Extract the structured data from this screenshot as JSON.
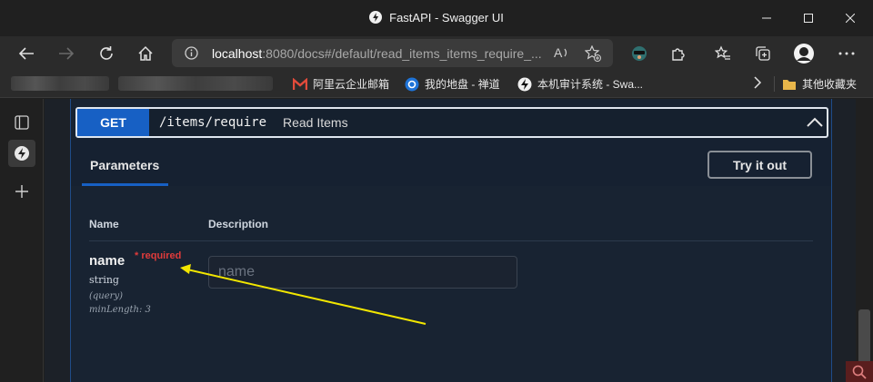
{
  "window": {
    "title": "FastAPI - Swagger UI"
  },
  "toolbar": {
    "url_host": "localhost",
    "url_rest": ":8080/docs#/default/read_items_items_require_..."
  },
  "bookmarks": {
    "items": [
      {
        "label": "阿里云企业邮箱"
      },
      {
        "label": "我的地盘 - 禅道"
      },
      {
        "label": "本机审计系统 - Swa..."
      }
    ],
    "other": "其他收藏夹"
  },
  "operation": {
    "method": "GET",
    "path": "/items/require",
    "description": "Read Items"
  },
  "parameters": {
    "tab_label": "Parameters",
    "try_label": "Try it out",
    "col_name": "Name",
    "col_description": "Description",
    "param": {
      "name": "name",
      "required_marker": "* required",
      "type": "string",
      "location": "(query)",
      "constraint": "minLength: 3",
      "placeholder": "name"
    }
  },
  "colors": {
    "accent_get": "#1760c4",
    "required": "#e03b3b",
    "annotation_arrow": "#f2e600"
  }
}
